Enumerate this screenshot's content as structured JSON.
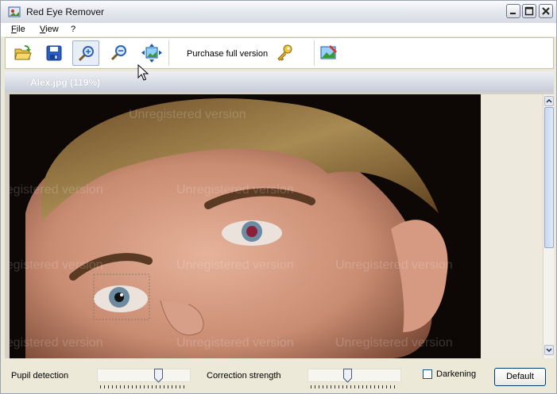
{
  "window": {
    "title": "Red Eye Remover"
  },
  "menu": [
    {
      "label": "File",
      "accel": "F",
      "rest": "ile"
    },
    {
      "label": "View",
      "accel": "V",
      "rest": "iew"
    },
    {
      "label": "?",
      "accel": "",
      "rest": "?"
    }
  ],
  "toolbar": {
    "buttons": [
      "open-folder-icon",
      "save-icon",
      "zoom-in-icon",
      "zoom-out-icon",
      "fit-to-window-icon",
      "key-icon",
      "edit-image-icon"
    ],
    "purchase_label": "Purchase full version"
  },
  "image": {
    "title": "Alex.jpg (119%)",
    "watermark": "Unregistered version"
  },
  "controls": {
    "pupil_detection_label": "Pupil detection",
    "pupil_detection_value": 0.67,
    "correction_strength_label": "Correction strength",
    "correction_strength_value": 0.42,
    "darkening_label": "Darkening",
    "darkening_checked": false,
    "default_label": "Default"
  },
  "colors": {
    "accent": "#0a246a",
    "title_text": "#ffffff"
  }
}
